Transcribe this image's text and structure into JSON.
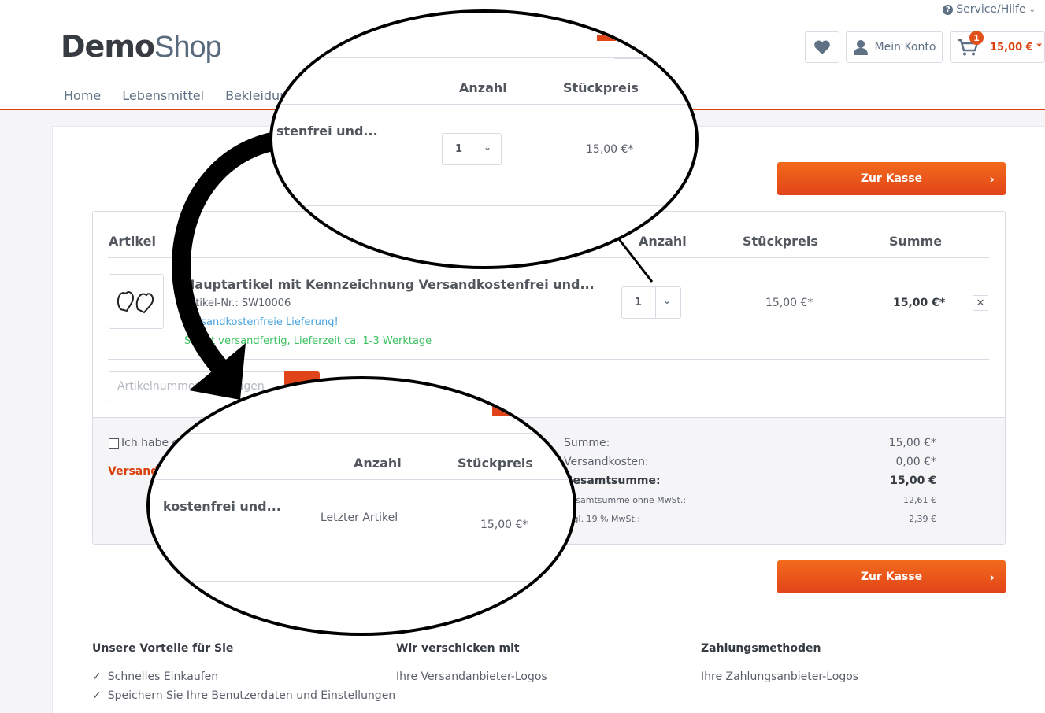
{
  "header": {
    "service": "Service/Hilfe",
    "logo_bold": "Demo",
    "logo_light": "Shop",
    "account_label": "Mein Konto",
    "cart_badge": "1",
    "cart_amount": "15,00 € *",
    "nav": [
      "Home",
      "Lebensmittel",
      "Bekleidung"
    ]
  },
  "checkout_button": "Zur Kasse",
  "table": {
    "col_article": "Artikel",
    "col_qty": "Anzahl",
    "col_price": "Stückpreis",
    "col_sum": "Summe"
  },
  "item": {
    "name": "Hauptartikel mit Kennzeichnung Versandkostenfrei und...",
    "nr": "Artikel-Nr.: SW10006",
    "shipping": "Versandkostenfreie Lieferung!",
    "stock": "Sofort versandfertig, Lieferzeit ca. 1-3 Werktage",
    "qty": "1",
    "unit_price": "15,00 €*",
    "total": "15,00 €*",
    "delete": "✕"
  },
  "add_article_placeholder": "Artikelnummer hinzufügen",
  "voucher_checkbox": "Ich habe einen Gutschein",
  "shipping_link": "Versandkosten berechnen",
  "summary": {
    "labels": [
      "Summe:",
      "Versandkosten:",
      "Gesamtsumme:",
      "Gesamtsumme ohne MwSt.:",
      "zzgl. 19 % MwSt.:"
    ],
    "values": [
      "15,00 €*",
      "0,00 €*",
      "15,00 €",
      "12,61 €",
      "2,39 €"
    ]
  },
  "footer": {
    "col1_title": "Unsere Vorteile für Sie",
    "col1_items": [
      "Schnelles Einkaufen",
      "Speichern Sie Ihre Benutzerdaten und Einstellungen"
    ],
    "col2_title": "Wir verschicken mit",
    "col2_text": "Ihre Versandanbieter-Logos",
    "col3_title": "Zahlungsmethoden",
    "col3_text": "Ihre Zahlungsanbieter-Logos"
  },
  "zoom_top": {
    "col_qty": "Anzahl",
    "col_price": "Stückpreis",
    "name_fragment": "stenfrei und...",
    "qty": "1",
    "price": "15,00 €*"
  },
  "zoom_bottom": {
    "col_qty": "Anzahl",
    "col_price": "Stückpreis",
    "name_fragment": "kostenfrei und...",
    "qty_text": "Letzter Artikel",
    "price": "15,00 €*"
  }
}
